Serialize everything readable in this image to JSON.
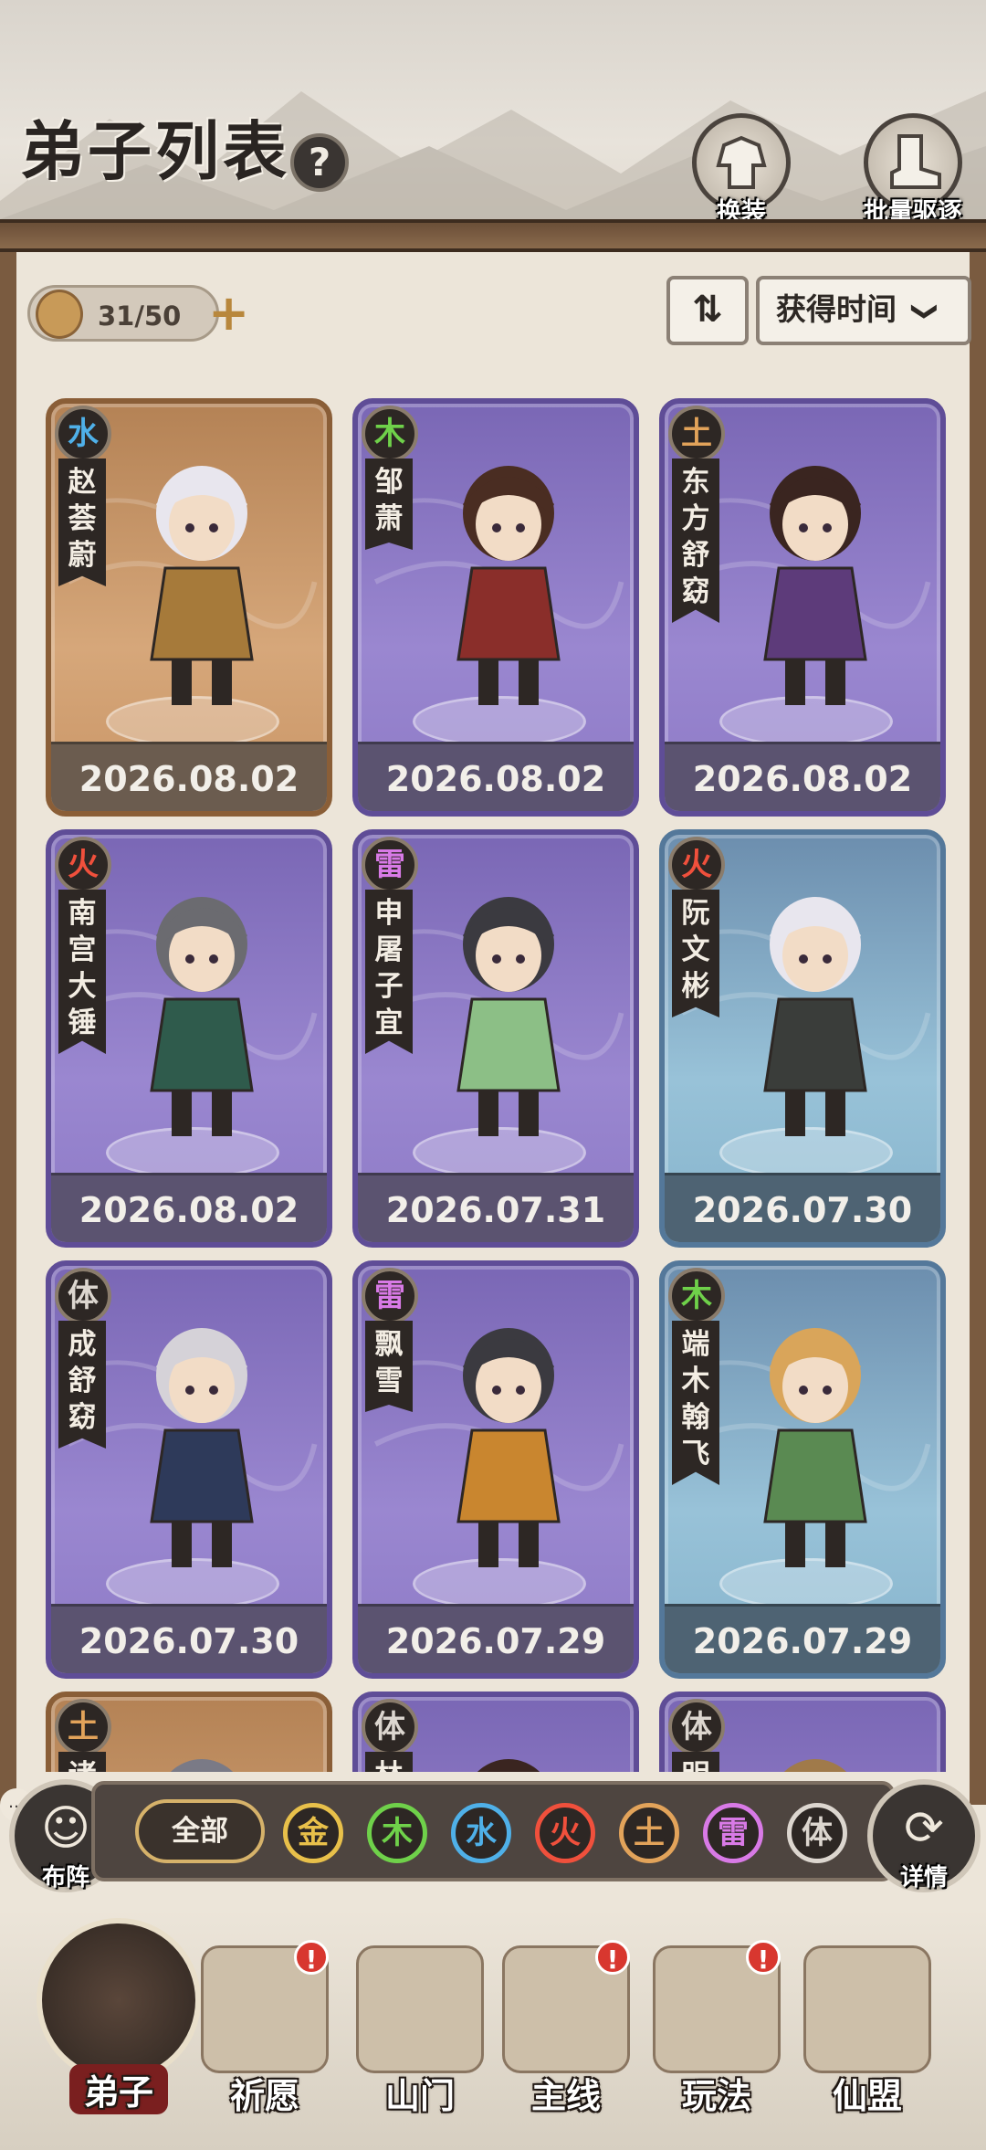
{
  "header": {
    "title": "弟子列表",
    "help_label": "?",
    "buttons": [
      {
        "label": "换装",
        "icon": "outfit-icon"
      },
      {
        "label": "批量驱逐",
        "icon": "boot-icon"
      }
    ]
  },
  "roster": {
    "count": "31/50",
    "plus_label": "+",
    "sort_order_icon": "⇅",
    "sort_label": "获得时间",
    "sort_caret": "❯"
  },
  "disciples": [
    {
      "element": "水",
      "element_color": "#4fb0e8",
      "name": [
        "赵",
        "荟",
        "蔚"
      ],
      "date": "2026.08.02",
      "rarity": "orange",
      "hair": "#e8e6ee",
      "robe": "#a67a3a"
    },
    {
      "element": "木",
      "element_color": "#6fd14a",
      "name": [
        "邹",
        "萧"
      ],
      "date": "2026.08.02",
      "rarity": "purple",
      "hair": "#4a2d22",
      "robe": "#8a2e2a"
    },
    {
      "element": "土",
      "element_color": "#e2a35a",
      "name": [
        "东",
        "方",
        "舒",
        "窈"
      ],
      "date": "2026.08.02",
      "rarity": "purple",
      "hair": "#3a2520",
      "robe": "#5d3b7a"
    },
    {
      "element": "火",
      "element_color": "#f0503c",
      "name": [
        "南",
        "宫",
        "大",
        "锤"
      ],
      "date": "2026.08.02",
      "rarity": "purple",
      "hair": "#6b6b70",
      "robe": "#2f5b4c"
    },
    {
      "element": "雷",
      "element_color": "#d87ae6",
      "name": [
        "申",
        "屠",
        "子",
        "宜"
      ],
      "date": "2026.07.31",
      "rarity": "purple",
      "hair": "#3b3a40",
      "robe": "#8cbf86"
    },
    {
      "element": "火",
      "element_color": "#f0503c",
      "name": [
        "阮",
        "文",
        "彬"
      ],
      "date": "2026.07.30",
      "rarity": "blue",
      "hair": "#e8e6ee",
      "robe": "#3a3d3a"
    },
    {
      "element": "体",
      "element_color": "#dcd6cf",
      "name": [
        "成",
        "舒",
        "窈"
      ],
      "date": "2026.07.30",
      "rarity": "purple",
      "hair": "#d5d2d8",
      "robe": "#2e3a5a"
    },
    {
      "element": "雷",
      "element_color": "#d87ae6",
      "name": [
        "飘",
        "雪"
      ],
      "date": "2026.07.29",
      "rarity": "purple",
      "hair": "#3b3a40",
      "robe": "#c9862f"
    },
    {
      "element": "木",
      "element_color": "#6fd14a",
      "name": [
        "端",
        "木",
        "翰",
        "飞"
      ],
      "date": "2026.07.29",
      "rarity": "blue",
      "hair": "#d9a55a",
      "robe": "#5a8a52"
    },
    {
      "element": "土",
      "element_color": "#e2a35a",
      "name": [
        "诸"
      ],
      "date": "",
      "rarity": "orange",
      "hair": "#7a7a86",
      "robe": "#a67a3a"
    },
    {
      "element": "体",
      "element_color": "#dcd6cf",
      "name": [
        "林"
      ],
      "date": "",
      "rarity": "purple",
      "hair": "#3a2520",
      "robe": "#5d3b7a"
    },
    {
      "element": "体",
      "element_color": "#dcd6cf",
      "name": [
        "明"
      ],
      "date": "",
      "rarity": "purple",
      "hair": "#a07a4a",
      "robe": "#5d3b7a"
    }
  ],
  "filters": {
    "all_label": "全部",
    "elements": [
      {
        "label": "金",
        "color": "#e8c04a"
      },
      {
        "label": "木",
        "color": "#6fd14a"
      },
      {
        "label": "水",
        "color": "#4fb0e8"
      },
      {
        "label": "火",
        "color": "#f0503c"
      },
      {
        "label": "土",
        "color": "#e2a35a"
      },
      {
        "label": "雷",
        "color": "#d87ae6"
      },
      {
        "label": "体",
        "color": "#dcd6cf"
      }
    ]
  },
  "side_buttons": {
    "formation_label": "布阵",
    "details_label": "详情"
  },
  "bottom_nav": [
    {
      "label": "弟子",
      "active": true,
      "badge": ""
    },
    {
      "label": "祈愿",
      "active": false,
      "badge": "!"
    },
    {
      "label": "山门",
      "active": false,
      "badge": ""
    },
    {
      "label": "主线",
      "active": false,
      "badge": "!"
    },
    {
      "label": "玩法",
      "active": false,
      "badge": "!"
    },
    {
      "label": "仙盟",
      "active": false,
      "badge": ""
    }
  ]
}
